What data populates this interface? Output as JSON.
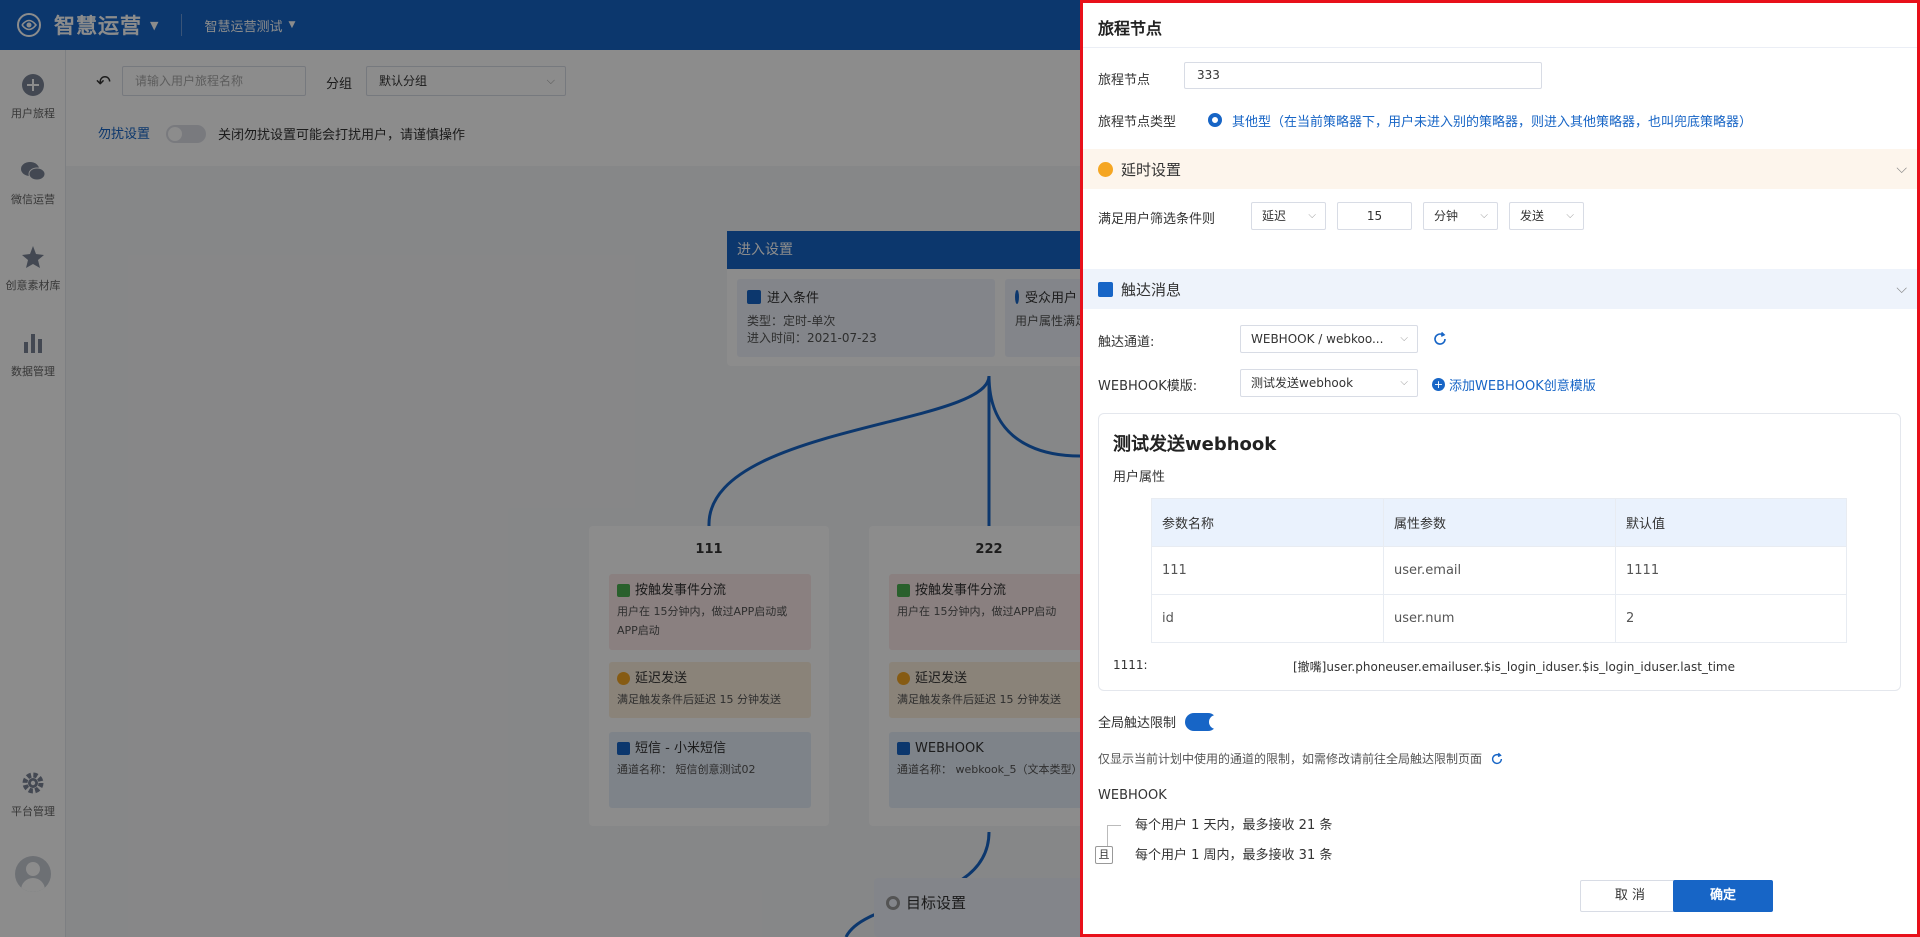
{
  "topbar": {
    "app_name": "智慧运营",
    "project": "智慧运营测试"
  },
  "sidenav": [
    {
      "label": "用户旅程",
      "icon": "journey-icon"
    },
    {
      "label": "微信运营",
      "icon": "wechat-icon"
    },
    {
      "label": "创意素材库",
      "icon": "creative-library-icon"
    },
    {
      "label": "数据管理",
      "icon": "bar-chart-icon"
    },
    {
      "label": "平台管理",
      "icon": "gear-icon"
    }
  ],
  "toolbar": {
    "search_placeholder": "请输入用户旅程名称",
    "group_label": "分组",
    "group_value": "默认分组",
    "dnd_label": "勿扰设置",
    "dnd_hint": "关闭勿扰设置可能会打扰用户，请谨慎操作"
  },
  "canvas": {
    "entry": {
      "header": "进入设置",
      "cond_title": "进入条件",
      "cond_type": "类型：定时-单次",
      "cond_time": "进入时间：2021-07-23",
      "audience_title": "受众用户",
      "audience_desc": "用户属性满足"
    },
    "branches": [
      {
        "name": "111",
        "trigger_title": "按触发事件分流",
        "trigger_desc": "用户在 15分钟内，做过APP启动或APP启动",
        "delay_title": "延迟发送",
        "delay_desc": "满足触发条件后延迟 15 分钟发送",
        "msg_title": "短信 - 小米短信",
        "msg_desc": "通道名称： 短信创意测试02"
      },
      {
        "name": "222",
        "trigger_title": "按触发事件分流",
        "trigger_desc": "用户在 15分钟内，做过APP启动",
        "delay_title": "延迟发送",
        "delay_desc": "满足触发条件后延迟 15 分钟发送",
        "msg_title": "WEBHOOK",
        "msg_desc": "通道名称： webkook_5（文本类型）"
      }
    ],
    "goal": "目标设置"
  },
  "drawer": {
    "title": "旅程节点",
    "node_label": "旅程节点",
    "node_value": "333",
    "type_label": "旅程节点类型",
    "type_value": "其他型（在当前策略器下，用户未进入别的策略器，则进入其他策略器，也叫兜底策略器）",
    "delay_section": "延时设置",
    "delay_condition_label": "满足用户筛选条件则",
    "delay_mode": "延迟",
    "delay_amount": "15",
    "delay_unit": "分钟",
    "delay_action": "发送",
    "message_section": "触达消息",
    "channel_label": "触达通道:",
    "channel_value": "WEBHOOK / webkoo...",
    "template_label": "WEBHOOK模版:",
    "template_value": "测试发送webhook",
    "add_template": "添加WEBHOOK创意模版",
    "template": {
      "title": "测试发送webhook",
      "subtitle": "用户属性",
      "columns": [
        "参数名称",
        "属性参数",
        "默认值"
      ],
      "rows": [
        [
          "111",
          "user.email",
          "1111"
        ],
        [
          "id",
          "user.num",
          "2"
        ]
      ],
      "footer_key": "1111:",
      "footer_value": "[撤嘴]user.phoneuser.emailuser.$is_login_iduser.$is_login_iduser.last_time"
    },
    "global_limit_label": "全局触达限制",
    "global_limit_on": true,
    "limit_hint": "仅显示当前计划中使用的通道的限制，如需修改请前往全局触达限制页面",
    "limit_channel": "WEBHOOK",
    "limit_rules": [
      "每个用户 1 天内，最多接收 21 条",
      "每个用户 1 周内，最多接收 31 条"
    ],
    "and_label": "且",
    "cancel_label": "取 消",
    "ok_label": "确定"
  },
  "colors": {
    "primary": "#1765c6",
    "highlight_border": "#e8101a"
  }
}
